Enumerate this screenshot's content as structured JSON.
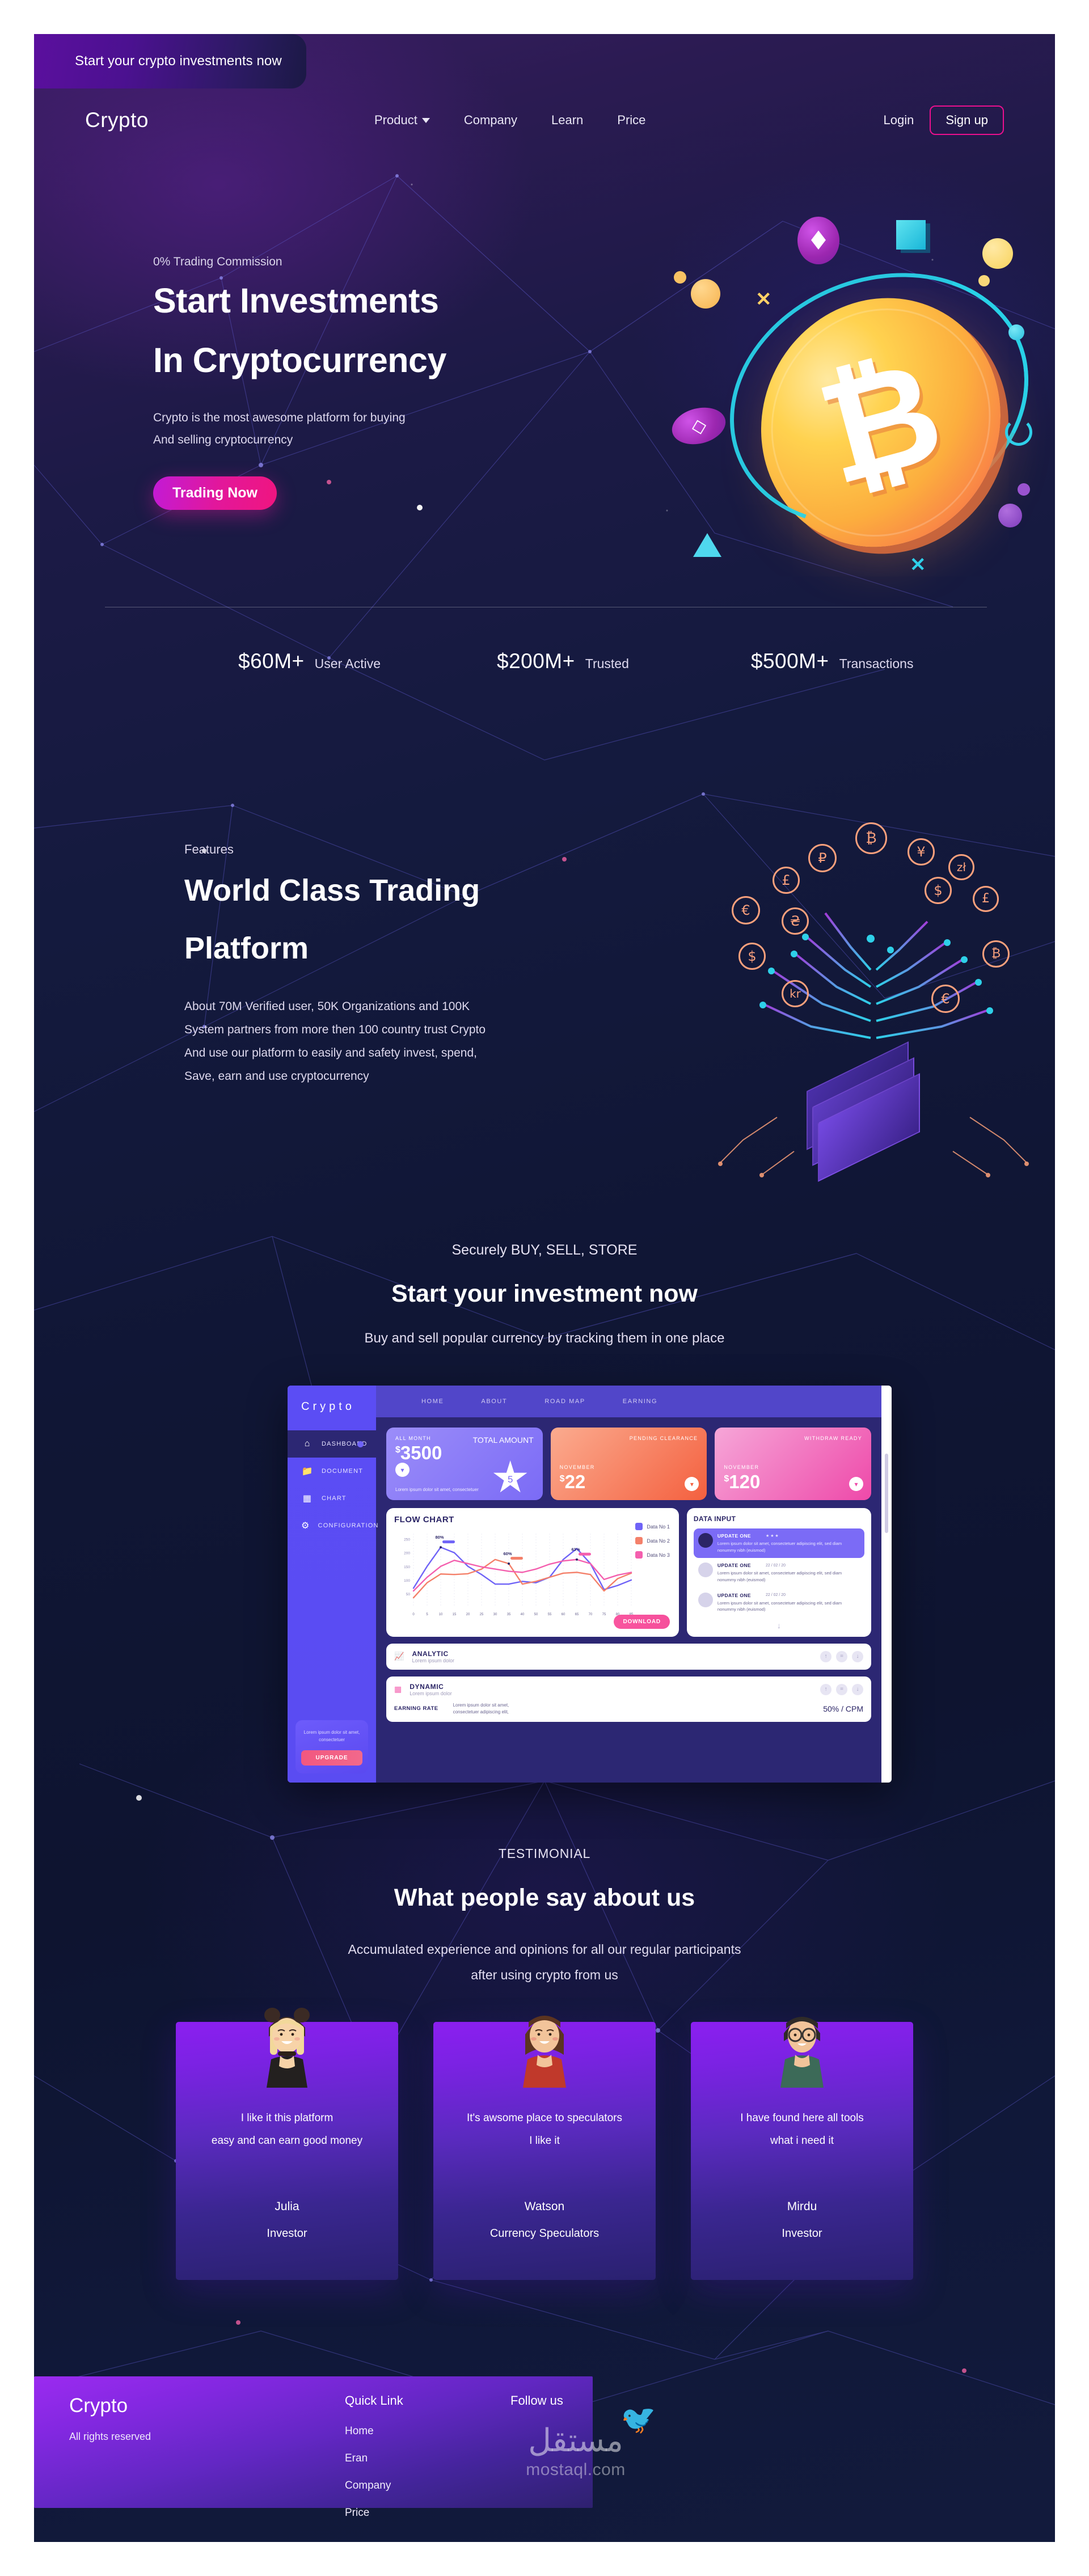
{
  "ribbon": {
    "text": "Start your crypto investments now"
  },
  "nav": {
    "brand": "Crypto",
    "links": [
      {
        "label": "Product",
        "has_caret": true
      },
      {
        "label": "Company",
        "has_caret": false
      },
      {
        "label": "Learn",
        "has_caret": false
      },
      {
        "label": "Price",
        "has_caret": false
      }
    ],
    "login": "Login",
    "signup": "Sign up"
  },
  "hero": {
    "eyebrow": "0% Trading Commission",
    "title_line1": "Start Investments",
    "title_line2": "In Cryptocurrency",
    "sub_line1": "Crypto is the most awesome platform for buying",
    "sub_line2": "And selling cryptocurrency",
    "cta": "Trading Now"
  },
  "stats": [
    {
      "value": "$60M+",
      "label": "User Active"
    },
    {
      "value": "$200M+",
      "label": "Trusted"
    },
    {
      "value": "$500M+",
      "label": "Transactions"
    }
  ],
  "features": {
    "eyebrow": "Features",
    "title_line1": "World Class Trading",
    "title_line2": "Platform",
    "body_line1": "About 70M Verified user, 50K Organizations and 100K",
    "body_line2": "System partners from more then 100 country trust Crypto",
    "body_line3": "And use our platform to easily and safety invest, spend,",
    "body_line4": "Save, earn and use cryptocurrency",
    "currency_symbols": [
      "₿",
      "₽",
      "¥",
      "zł",
      "£",
      "$",
      "£",
      "€",
      "₴",
      "$",
      "₿",
      "kr",
      "€"
    ]
  },
  "invest": {
    "eyebrow": "Securely BUY, SELL, STORE",
    "title": "Start your investment now",
    "sub": "Buy and sell popular currency by tracking them in one place"
  },
  "dashboard": {
    "logo": "Crypto",
    "sidebar": [
      {
        "label": "DASHBOARD",
        "icon": "home-icon",
        "active": true
      },
      {
        "label": "DOCUMENT",
        "icon": "folder-icon",
        "active": false
      },
      {
        "label": "CHART",
        "icon": "bar-chart-icon",
        "active": false
      },
      {
        "label": "CONFIGURATION",
        "icon": "gear-icon",
        "active": false
      }
    ],
    "promo_text": "Lorem ipsum dolor sit amet, consectetuer",
    "upgrade": "UPGRADE",
    "topnav": [
      "HOME",
      "ABOUT",
      "ROAD MAP",
      "EARNING"
    ],
    "cards": [
      {
        "title": "ALL MONTH",
        "amount": "3500",
        "currency": "$",
        "title_right": "TOTAL AMOUNT",
        "lorem": "Lorem ipsum dolor sit amet, consectetuer",
        "badge": "5",
        "theme": "purple"
      },
      {
        "title": "PENDING CLEARANCE",
        "month": "NOVEMBER",
        "amount": "22",
        "currency": "$",
        "theme": "red"
      },
      {
        "title": "WITHDRAW READY",
        "month": "NOVEMBER",
        "amount": "120",
        "currency": "$",
        "theme": "pink"
      }
    ],
    "flow": {
      "title": "FLOW CHART",
      "legend": [
        "Data No 1",
        "Data No 2",
        "Data No 3"
      ],
      "download": "DOWNLOAD"
    },
    "data_input": {
      "title": "DATA INPUT",
      "items": [
        {
          "title": "UPDATE ONE",
          "meta": "★ ★ ★",
          "body": "Lorem ipsum dolor sit amet, consectetuer adipiscing elit, sed diam nonummy nibh (euismod)",
          "highlight": true
        },
        {
          "title": "UPDATE ONE",
          "meta": "22 / 02 / 20",
          "body": "Lorem ipsum dolor sit amet, consectetuer adipiscing elit, sed diam nonummy nibh (euismod)",
          "highlight": false
        },
        {
          "title": "UPDATE ONE",
          "meta": "22 / 02 / 20",
          "body": "Lorem ipsum dolor sit amet, consectetuer adipiscing elit, sed diam nonummy nibh (euismod)",
          "highlight": false
        }
      ]
    },
    "rows": [
      {
        "title": "ANALYTIC",
        "sub": "Lorem ipsum dolor"
      },
      {
        "title": "DYNAMIC",
        "sub": "Lorem ipsum dolor"
      }
    ],
    "earning": {
      "label": "EARNING RATE",
      "desc_line1": "Lorem ipsum dolor sit amet,",
      "desc_line2": "consectetuer adipiscing elit,",
      "value": "50% / CPM"
    }
  },
  "chart_data": {
    "type": "line",
    "title": "FLOW CHART",
    "xlabel": "",
    "ylabel": "",
    "x": [
      0,
      5,
      10,
      15,
      20,
      25,
      30,
      35,
      40,
      50,
      55,
      60,
      65,
      70,
      75,
      80,
      85
    ],
    "xticks": [
      "0",
      "5",
      "10",
      "15",
      "20",
      "25",
      "30",
      "35",
      "40",
      "50",
      "55",
      "60",
      "65",
      "70",
      "75",
      "80",
      "85"
    ],
    "yticks": [
      "50",
      "100",
      "150",
      "200",
      "250"
    ],
    "ylim": [
      0,
      270
    ],
    "grid": true,
    "legend": [
      "Data No 1",
      "Data No 2",
      "Data No 3"
    ],
    "legend_position": "right",
    "series": [
      {
        "name": "Data No 1",
        "color": "#6f63f7",
        "values": [
          70,
          150,
          220,
          200,
          150,
          120,
          85,
          85,
          95,
          90,
          110,
          175,
          215,
          160,
          65,
          80,
          100
        ]
      },
      {
        "name": "Data No 2",
        "color": "#f4806a",
        "values": [
          35,
          90,
          122,
          120,
          123,
          140,
          175,
          160,
          85,
          95,
          110,
          125,
          128,
          120,
          60,
          105,
          125
        ]
      },
      {
        "name": "Data No 3",
        "color": "#f45fae",
        "values": [
          60,
          110,
          150,
          172,
          160,
          148,
          140,
          132,
          128,
          140,
          158,
          170,
          175,
          160,
          102,
          118,
          128
        ]
      }
    ],
    "annotations": [
      {
        "label": "80%",
        "x": 12,
        "series": "Data No 1"
      },
      {
        "label": "60%",
        "x": 34,
        "series": "Data No 2"
      },
      {
        "label": "63%",
        "x": 66,
        "series": "Data No 3"
      }
    ]
  },
  "testimonial": {
    "eyebrow": "TESTIMONIAL",
    "title": "What people say about us",
    "sub_line1": "Accumulated experience and opinions for all our regular participants",
    "sub_line2": "after using crypto from us",
    "cards": [
      {
        "quote_line1": "I like it this platform",
        "quote_line2": "easy and can earn good money",
        "name": "Julia",
        "role": "Investor",
        "avatar": "woman-blonde-avatar"
      },
      {
        "quote_line1": "It's awsome place to speculators",
        "quote_line2": "I like it",
        "name": "Watson",
        "role": "Currency Speculators",
        "avatar": "woman-brunette-avatar"
      },
      {
        "quote_line1": "I have found here all tools",
        "quote_line2": "what i need it",
        "name": "Mirdu",
        "role": "Investor",
        "avatar": "man-glasses-avatar"
      }
    ]
  },
  "footer": {
    "brand": "Crypto",
    "rights": "All rights reserved",
    "quick_link_title": "Quick Link",
    "quick_links": [
      "Home",
      "Eran",
      "Company",
      "Price"
    ],
    "follow_title": "Follow us",
    "watermark_ar": "مستقل",
    "watermark": "mostaql.com"
  },
  "colors": {
    "accent_pink": "#ec0f8e",
    "accent_purple": "#8b1ff0",
    "dash_blue": "#5b4df4",
    "coin_gold": "#ffd24f"
  }
}
